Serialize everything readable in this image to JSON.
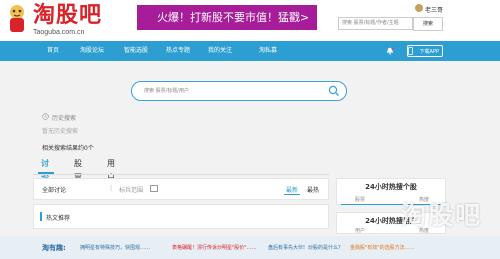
{
  "logo": {
    "name": "淘股吧",
    "site": "Taoguba.com.cn"
  },
  "banner": {
    "text": "火爆！打新股不要市值！猛戳>"
  },
  "user": {
    "name": "老三哥"
  },
  "top_search": {
    "placeholder": "搜索 股票/标题/作者/主题",
    "button": "搜索"
  },
  "nav": {
    "items": [
      "首页",
      "淘股论坛",
      "智能选股",
      "热点专题",
      "我的关注",
      "淘私募"
    ],
    "app_button": "下载APP"
  },
  "search": {
    "placeholder": "搜索 股票/标题/用户"
  },
  "history": {
    "label": "历史搜索",
    "empty": "暂无历史搜索"
  },
  "results": {
    "count_text": "相关搜索结果约0个"
  },
  "tabs": [
    "讨论",
    "股票",
    "用户"
  ],
  "discussion_panel": {
    "title": "全部讨论",
    "separator": "|",
    "filter": "标兵范围",
    "sort_new": "最新",
    "sort_hot": "最热"
  },
  "recommend_panel": {
    "title": "热文推荐"
  },
  "side": {
    "hot_stocks": {
      "title": "24小时热搜个股",
      "tab1": "股票",
      "tab2": "热度"
    },
    "hot_users": {
      "title": "24小时热搜用户",
      "tab1": "用户",
      "tab2": "热度"
    }
  },
  "bottom": {
    "brand": "淘有趣:",
    "links": [
      "拥明星有特殊技巧，快围观……",
      "表格碾醒！漂行传诉炒明星\"股价\"……",
      "盘后有事先大伙!",
      "炒股的是什么？",
      "金融股\"有效\"的选股方法……"
    ]
  },
  "watermark": "淘股吧",
  "colors": {
    "nav": "#2d9ed1",
    "banner": "#a71d99",
    "brand_red": "#d9232a"
  }
}
